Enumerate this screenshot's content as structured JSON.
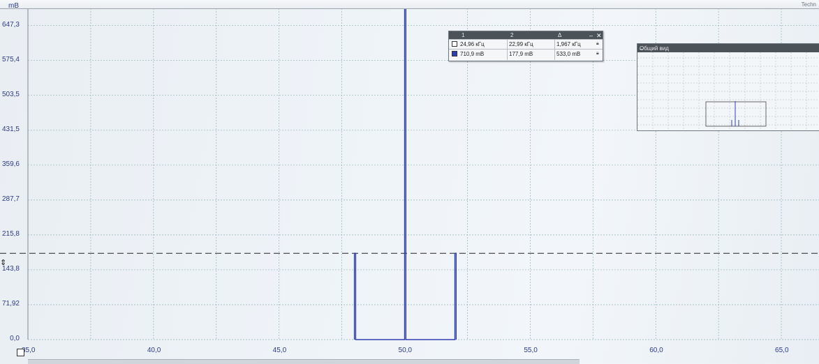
{
  "brand_text": "Techn",
  "chart_data": {
    "type": "line",
    "ylabel": "mB",
    "y_ticks": [
      "0,0",
      "71,92",
      "143,8",
      "215,8",
      "287,7",
      "359,6",
      "431,5",
      "503,5",
      "575,4",
      "647,3"
    ],
    "y_tick_values": [
      0,
      71.92,
      143.8,
      215.8,
      287.7,
      359.6,
      431.5,
      503.5,
      575.4,
      647.3
    ],
    "x_ticks": [
      "35,0",
      "40,0",
      "45,0",
      "50,0",
      "55,0",
      "60,0",
      "65,0"
    ],
    "x_tick_values": [
      35,
      40,
      45,
      50,
      55,
      60,
      65
    ],
    "xlim": [
      35,
      66.5
    ],
    "ylim": [
      0,
      700
    ],
    "grid": true,
    "series": [
      {
        "color": "#2f3fb0",
        "points": [
          {
            "x": 48.0,
            "y": 0
          },
          {
            "x": 48.0,
            "y": 178
          },
          {
            "x": 48.05,
            "y": 178
          },
          {
            "x": 48.05,
            "y": 0
          },
          {
            "x": 50.0,
            "y": 0
          },
          {
            "x": 50.0,
            "y": 711
          },
          {
            "x": 50.05,
            "y": 711
          },
          {
            "x": 50.05,
            "y": 0
          },
          {
            "x": 52.0,
            "y": 0
          },
          {
            "x": 52.0,
            "y": 178
          },
          {
            "x": 52.05,
            "y": 178
          },
          {
            "x": 52.05,
            "y": 0
          }
        ]
      }
    ],
    "reference_lines": [
      {
        "name": "marker-1-level",
        "y": 710.9
      },
      {
        "name": "marker-2-level",
        "y": 177.9
      }
    ]
  },
  "marker_table": {
    "headers": [
      "1",
      "2",
      "Δ"
    ],
    "rows": [
      {
        "swatch": "#ffffff",
        "c1": "24,96 кГц",
        "c2": "22,99 кГц",
        "c3": "1,967 кГц"
      },
      {
        "swatch": "#2f3fb0",
        "c1": "710,9 mB",
        "c2": "177,9 mB",
        "c3": "533,0 mB"
      }
    ]
  },
  "overview": {
    "title": "Общий вид"
  }
}
